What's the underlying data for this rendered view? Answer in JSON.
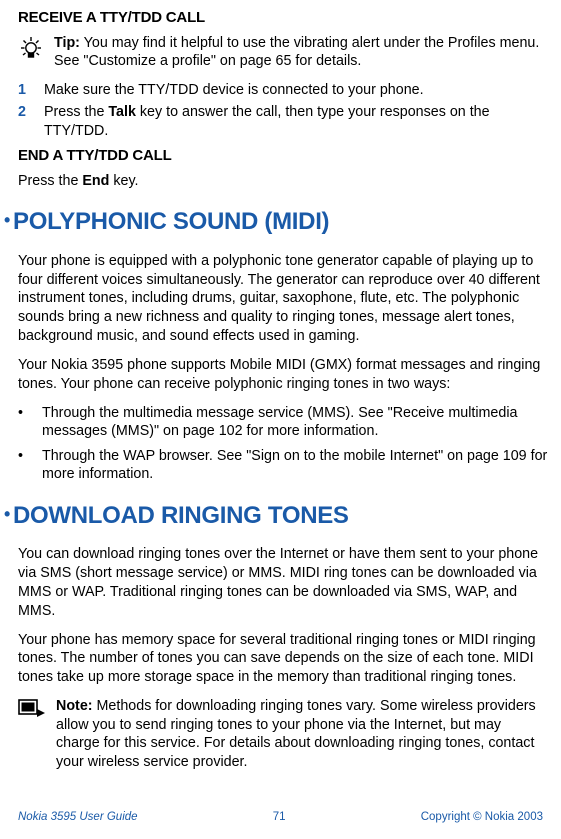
{
  "receive_heading": "RECEIVE A TTY/TDD CALL",
  "tip": {
    "label": "Tip:",
    "text": " You may find it helpful to use the vibrating alert under the Profiles menu. See \"Customize a profile\" on page 65 for details."
  },
  "steps": [
    {
      "num": "1",
      "text": "Make sure the TTY/TDD device is connected to your phone."
    },
    {
      "num": "2",
      "before": "Press the ",
      "bold": "Talk",
      "after": " key to answer the call, then type your responses on the TTY/TDD."
    }
  ],
  "end_heading": "END A TTY/TDD CALL",
  "end_para": {
    "before": "Press the ",
    "bold": "End",
    "after": " key."
  },
  "polyphonic": {
    "heading": "POLYPHONIC SOUND (MIDI)",
    "para1": "Your phone is equipped with a polyphonic tone generator capable of playing up to four different voices simultaneously. The generator can reproduce over 40 different instrument tones, including drums, guitar, saxophone, flute, etc. The polyphonic sounds bring a new richness and quality to ringing tones, message alert tones, background music, and sound effects used in gaming.",
    "para2": "Your Nokia 3595 phone supports Mobile MIDI (GMX) format messages and ringing tones. Your phone can receive polyphonic ringing tones in two ways:",
    "bullets": [
      "Through the multimedia message service (MMS). See \"Receive multimedia messages (MMS)\" on page 102 for more information.",
      "Through the WAP browser. See \"Sign on to the mobile Internet\" on page 109 for more information."
    ]
  },
  "download": {
    "heading": "DOWNLOAD RINGING TONES",
    "para1": "You can download ringing tones over the Internet or have them sent to your phone via SMS (short message service) or MMS. MIDI ring tones can be downloaded via MMS or WAP. Traditional ringing tones can be downloaded via SMS, WAP, and MMS.",
    "para2": "Your phone has memory space for several traditional ringing tones or MIDI ringing tones. The number of tones you can save depends on the size of each tone. MIDI tones take up more storage space in the memory than traditional ringing tones.",
    "note_label": "Note:",
    "note_text": "  Methods for downloading ringing tones vary. Some wireless providers allow you to send ringing tones to your phone via the Internet, but may charge for this service. For details about downloading ringing tones, contact your wireless service provider."
  },
  "footer": {
    "left": "Nokia 3595 User Guide",
    "page": "71",
    "right": "Copyright © Nokia 2003"
  },
  "chart_data": {
    "type": "table",
    "note": "document page, no chart data"
  }
}
